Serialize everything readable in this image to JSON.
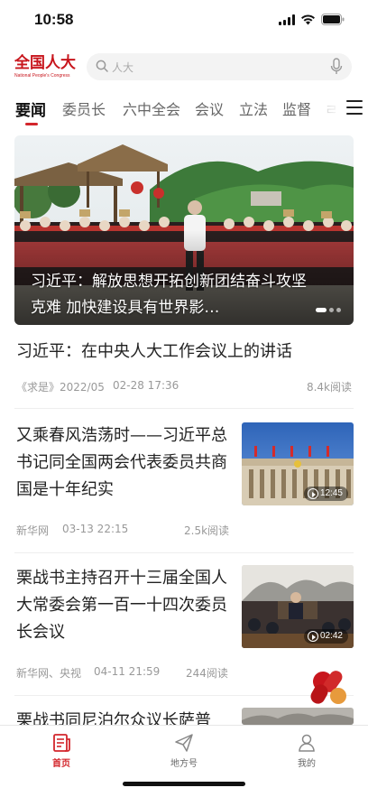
{
  "status_bar": {
    "time": "10:58"
  },
  "header": {
    "logo_cn": "全国人大",
    "logo_en": "National People's Congress",
    "search_placeholder": "人大"
  },
  "tabs": [
    {
      "label": "要闻",
      "active": true
    },
    {
      "label": "委员长"
    },
    {
      "label": "六中全会"
    },
    {
      "label": "会议"
    },
    {
      "label": "立法"
    },
    {
      "label": "监督"
    },
    {
      "label": "ㄹ"
    }
  ],
  "hero": {
    "caption": "习近平：解放思想开拓创新团结奋斗攻坚克难 加快建设具有世界影…"
  },
  "featured_article": {
    "title": "习近平：在中央人大工作会议上的讲话",
    "source": "《求是》2022/05",
    "time": "02-28 17:36",
    "reads": "8.4k阅读"
  },
  "news": [
    {
      "title": "又乘春风浩荡时——习近平总书记同全国两会代表委员共商国是十年纪实",
      "source": "新华网",
      "time": "03-13 22:15",
      "reads": "2.5k阅读",
      "duration": "12:45"
    },
    {
      "title": "栗战书主持召开十三届全国人大常委会第一百一十四次委员长会议",
      "source": "新华网、央视",
      "time": "04-11 21:59",
      "reads": "244阅读",
      "duration": "02:42"
    },
    {
      "title": "栗战书同尼泊尔众议长萨普"
    }
  ],
  "bottom_nav": [
    {
      "label": "首页",
      "active": true,
      "icon": "news-icon"
    },
    {
      "label": "地方号",
      "icon": "paper-plane-icon"
    },
    {
      "label": "我的",
      "icon": "profile-icon"
    }
  ],
  "colors": {
    "accent": "#d3262c",
    "brand": "#c8161d"
  }
}
